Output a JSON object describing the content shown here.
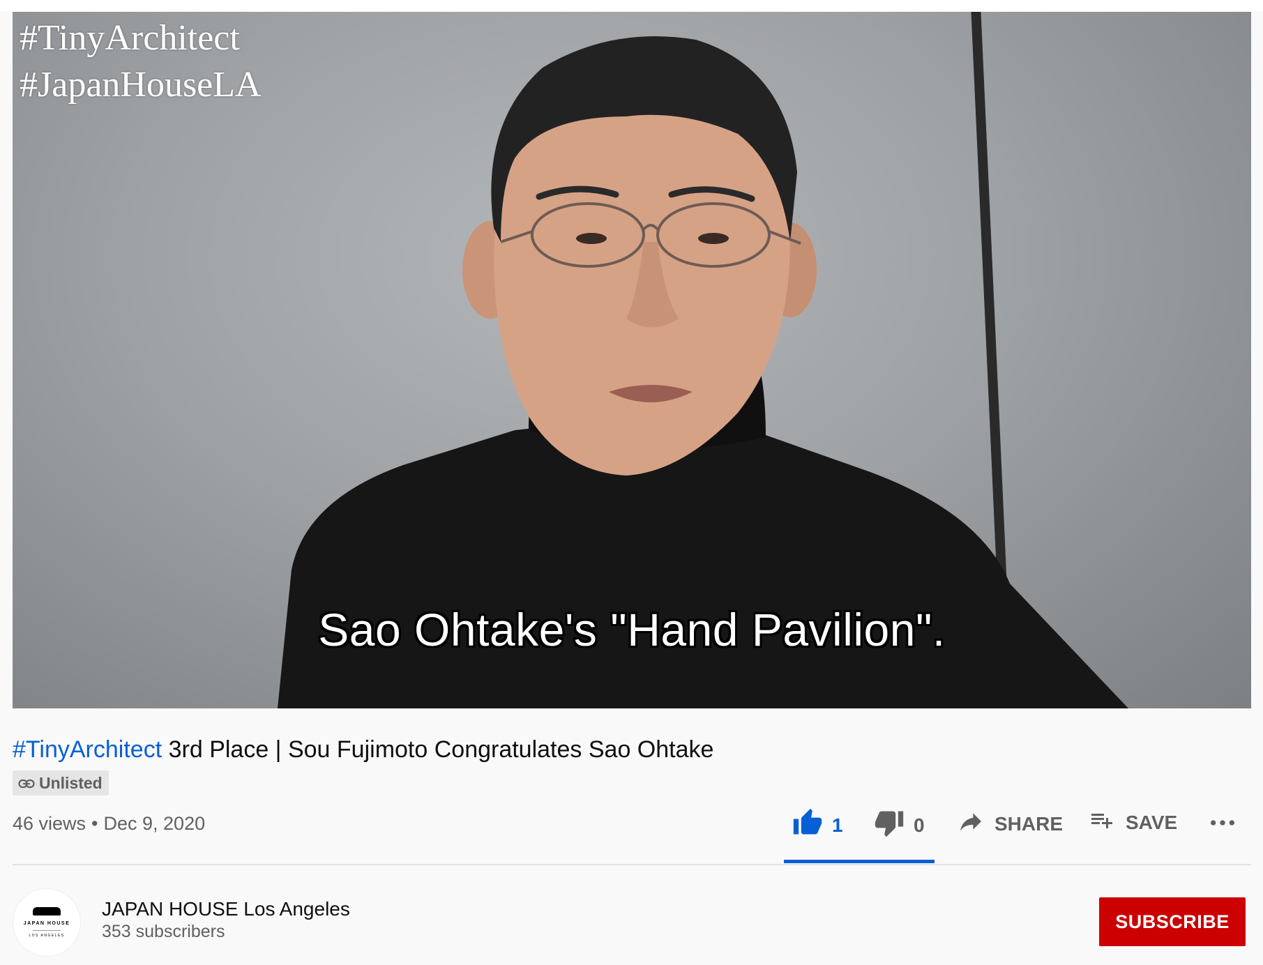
{
  "video": {
    "overlay_hashtags": [
      "#TinyArchitect",
      "#JapanHouseLA"
    ],
    "subtitle": "Sao Ohtake's \"Hand Pavilion\"."
  },
  "title": {
    "hashtag": "#TinyArchitect",
    "text": " 3rd Place | Sou Fujimoto Congratulates Sao Ohtake"
  },
  "badge": {
    "label": "Unlisted",
    "icon": "link-icon"
  },
  "meta": {
    "views": "46 views",
    "separator": "•",
    "date": "Dec 9, 2020"
  },
  "actions": {
    "like": {
      "icon": "thumbs-up-icon",
      "count": "1"
    },
    "dislike": {
      "icon": "thumbs-down-icon",
      "count": "0"
    },
    "share": {
      "icon": "share-arrow-icon",
      "label": "SHARE"
    },
    "save": {
      "icon": "playlist-add-icon",
      "label": "SAVE"
    },
    "more": {
      "icon": "more-horizontal-icon"
    }
  },
  "channel": {
    "name": "JAPAN HOUSE Los Angeles",
    "subscribers": "353 subscribers",
    "avatar_text_top": "JAPAN HOUSE",
    "avatar_text_bottom": "LOS ANGELES"
  },
  "subscribe": {
    "label": "SUBSCRIBE"
  },
  "colors": {
    "link_blue": "#065fd4",
    "subscribe_red": "#cc0000",
    "secondary_text": "#606060",
    "primary_text": "#0f0f0f"
  }
}
